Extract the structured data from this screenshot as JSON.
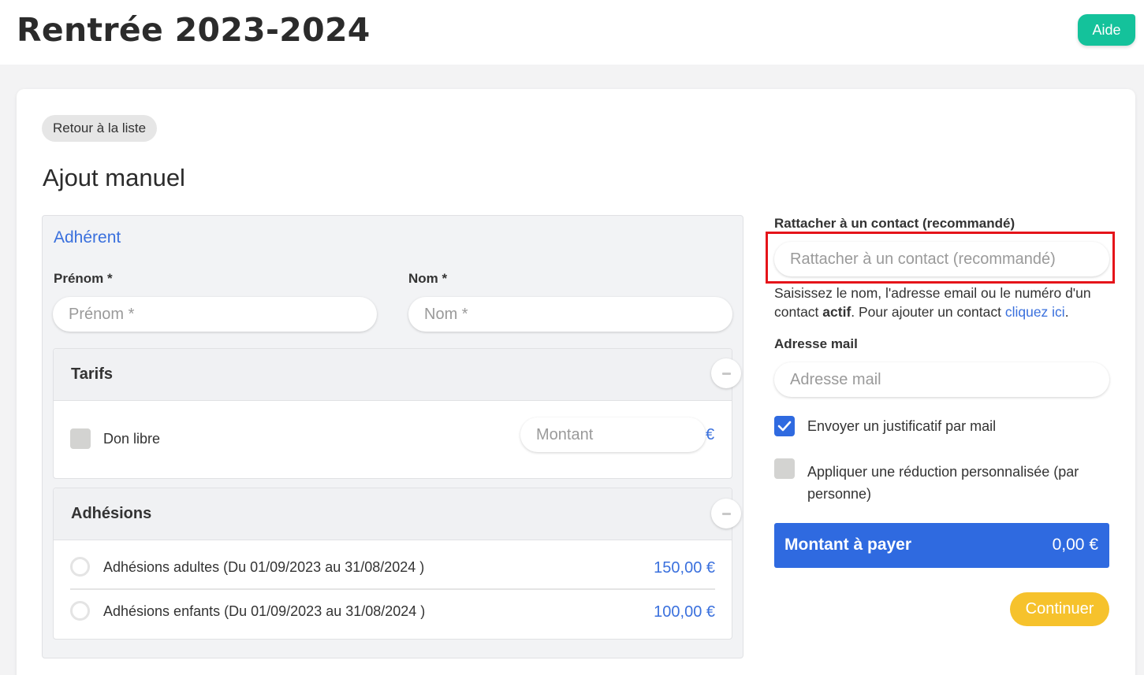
{
  "header": {
    "title": "Rentrée 2023-2024",
    "help_label": "Aide"
  },
  "back_label": "Retour à la liste",
  "section_title": "Ajout manuel",
  "member": {
    "title": "Adhérent",
    "firstname_label": "Prénom *",
    "firstname_placeholder": "Prénom *",
    "lastname_label": "Nom *",
    "lastname_placeholder": "Nom *"
  },
  "tarifs": {
    "title": "Tarifs",
    "donation_label": "Don libre",
    "donation_checked": false,
    "amount_placeholder": "Montant",
    "currency": "€"
  },
  "adhesions": {
    "title": "Adhésions",
    "items": [
      {
        "label": "Adhésions adultes (Du 01/09/2023 au 31/08/2024 )",
        "price": "150,00 €"
      },
      {
        "label": "Adhésions enfants (Du 01/09/2023 au 31/08/2024 )",
        "price": "100,00 €"
      }
    ]
  },
  "contact": {
    "label": "Rattacher à un contact (recommandé)",
    "placeholder": "Rattacher à un contact (recommandé)",
    "help_part1": "Saisissez le nom, l'adresse email ou le numéro d'un contact ",
    "help_bold": "actif",
    "help_part2": ". Pour ajouter un contact ",
    "help_link": "cliquez ici",
    "help_end": "."
  },
  "email": {
    "label": "Adresse mail",
    "placeholder": "Adresse mail"
  },
  "options": {
    "send_receipt_label": "Envoyer un justificatif par mail",
    "send_receipt_checked": true,
    "custom_discount_label": "Appliquer une réduction personnalisée (par personne)",
    "custom_discount_checked": false
  },
  "payment": {
    "label": "Montant à payer",
    "amount": "0,00 €"
  },
  "continue_label": "Continuer",
  "colors": {
    "accent_blue": "#2f6ae0",
    "help_green": "#14c29b",
    "continue_yellow": "#f6c22c",
    "highlight_red": "#e5141a"
  }
}
